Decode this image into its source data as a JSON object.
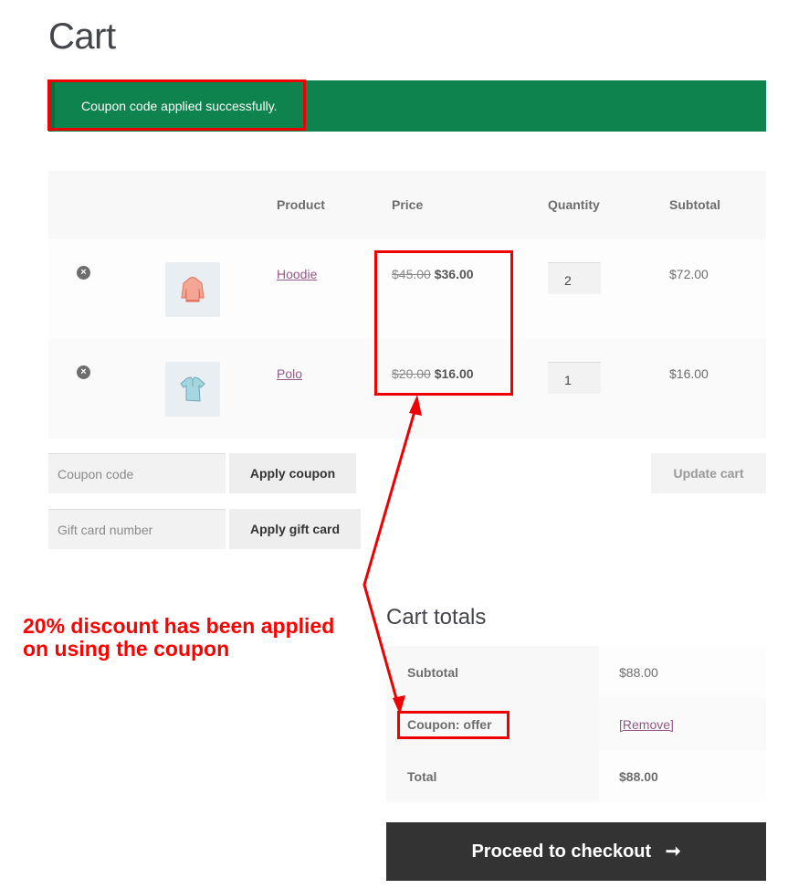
{
  "page": {
    "title": "Cart"
  },
  "notice": {
    "message": "Coupon code applied successfully."
  },
  "cart_table": {
    "headers": {
      "product": "Product",
      "price": "Price",
      "quantity": "Quantity",
      "subtotal": "Subtotal"
    },
    "rows": [
      {
        "product": "Hoodie",
        "regular_price": "$45.00",
        "sale_price": "$36.00",
        "quantity": "2",
        "subtotal": "$72.00",
        "thumb_icon": "hoodie-image",
        "remove_icon": "remove-icon"
      },
      {
        "product": "Polo",
        "regular_price": "$20.00",
        "sale_price": "$16.00",
        "quantity": "1",
        "subtotal": "$16.00",
        "thumb_icon": "polo-shirt-image",
        "remove_icon": "remove-icon"
      }
    ]
  },
  "actions": {
    "coupon_placeholder": "Coupon code",
    "apply_coupon": "Apply coupon",
    "gift_card_placeholder": "Gift card number",
    "apply_gift_card": "Apply gift card",
    "update_cart": "Update cart"
  },
  "cart_totals": {
    "title": "Cart totals",
    "rows": [
      {
        "label": "Subtotal",
        "value": "$88.00"
      },
      {
        "label": "Coupon: offer",
        "value": "[Remove]"
      },
      {
        "label": "Total",
        "value": "$88.00"
      }
    ],
    "checkout_label": "Proceed to checkout",
    "checkout_icon": "arrow-right-icon",
    "checkout_arrow": "➞"
  },
  "annotation": {
    "line1": "20% discount has been applied",
    "line2": "on using the coupon",
    "color": "#ff0000"
  },
  "colors": {
    "notice_bg": "#0f834d",
    "link": "#96588a",
    "checkout_bg": "#333333"
  }
}
